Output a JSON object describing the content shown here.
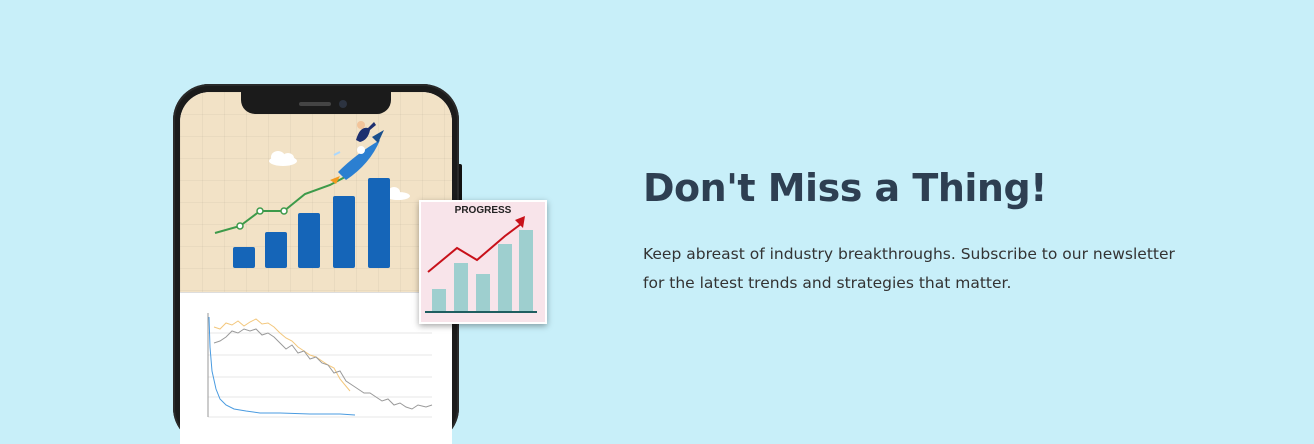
{
  "newsletter": {
    "heading": "Don't Miss a Thing!",
    "body_line_1": "Keep abreast of industry breakthroughs. Subscribe to our newsletter",
    "body_line_2": "for the latest trends and strategies that matter."
  },
  "progress_card": {
    "title": "PROGRESS"
  },
  "colors": {
    "background": "#c8eff9",
    "heading": "#2e3f52",
    "bar_blue": "#1565b8",
    "progress_bar": "#9ecfcf",
    "progress_arrow": "#c8111a"
  }
}
